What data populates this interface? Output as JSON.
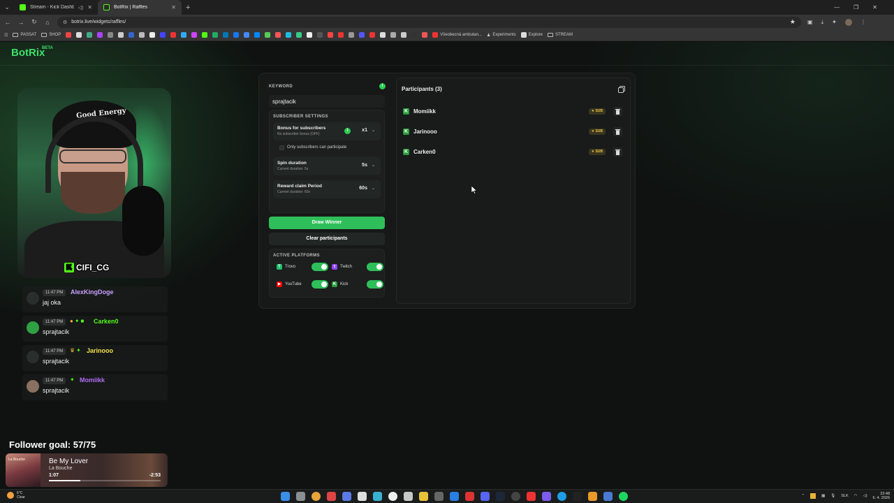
{
  "browser": {
    "tabs": [
      {
        "label": "Stream - Kick Dashboard",
        "active": false
      },
      {
        "label": "BotRix | Raffles",
        "active": true
      }
    ],
    "url": "botrix.live/widgets/raffles/",
    "bookmarks": [
      {
        "label": "PASSAT",
        "type": "folder"
      },
      {
        "label": "SHOP",
        "type": "folder"
      },
      {
        "label": "Všeobecná ambulan...",
        "type": "site"
      },
      {
        "label": "Experiments",
        "type": "site"
      },
      {
        "label": "Explore",
        "type": "site"
      },
      {
        "label": "STREAM",
        "type": "folder"
      }
    ]
  },
  "brand": {
    "name": "BotRix",
    "badge": "BETA",
    "color": "#3ee06b"
  },
  "webcam": {
    "tag": "CIFI_CG",
    "cap_text": "Good Energy"
  },
  "chat": [
    {
      "time": "11:47 PM",
      "user": "AlexKingDoge",
      "message": "jaj oka",
      "color": "#c9a0ff",
      "badges": []
    },
    {
      "time": "11:47 PM",
      "user": "Carken0",
      "message": "sprajtacik",
      "color": "#53fc18",
      "badges": [
        "gold",
        "green",
        "green"
      ]
    },
    {
      "time": "11:47 PM",
      "user": "Jarinooo",
      "message": "sprajtacik",
      "color": "#f3e24a",
      "badges": [
        "gold",
        "green"
      ]
    },
    {
      "time": "11:47 PM",
      "user": "Momiikk",
      "message": "sprajtacik",
      "color": "#b46ef5",
      "badges": [
        "green"
      ]
    }
  ],
  "follower_goal": "Follower goal: 57/75",
  "music": {
    "title": "Be My Lover",
    "artist": "La Bouche",
    "elapsed": "1:07",
    "remaining": "-2:53",
    "progress_fraction": 0.28,
    "album_text": "La Bouche"
  },
  "raffle": {
    "keyword_label": "KEYWORD",
    "keyword_value": "sprajtacik",
    "subscriber_settings_label": "SUBSCRIBER SETTINGS",
    "bonus": {
      "title": "Bonus for subscribers",
      "subtitle": "No subscriber bonus (OFF)",
      "value": "x1"
    },
    "only_subscribers_label": "Only subscribers can participate",
    "only_subscribers_checked": false,
    "spin": {
      "title": "Spin duration",
      "subtitle": "Current duration: 5s",
      "value": "5s"
    },
    "reward": {
      "title": "Reward claim Period",
      "subtitle": "Current duration: 60s",
      "value": "60s"
    },
    "draw_button": "Draw Winner",
    "clear_button": "Clear participants",
    "platforms_label": "ACTIVE PLATFORMS",
    "platforms": [
      {
        "name": "Trovo",
        "enabled": true,
        "color": "#1cbe6e"
      },
      {
        "name": "Twitch",
        "enabled": true,
        "color": "#9146ff"
      },
      {
        "name": "YouTube",
        "enabled": true,
        "color": "#ff0000"
      },
      {
        "name": "Kick",
        "enabled": true,
        "color": "#53fc18"
      }
    ],
    "participants_title": "Participants (3)",
    "participants": [
      {
        "name": "Momiikk",
        "badge": "SUB"
      },
      {
        "name": "Jarinooo",
        "badge": "SUB"
      },
      {
        "name": "Carken0",
        "badge": "SUB"
      }
    ]
  },
  "taskbar": {
    "weather_temp": "6°C",
    "weather_desc": "Clear",
    "language": "SLK",
    "time": "23:48",
    "date": "6. 4. 2026"
  }
}
